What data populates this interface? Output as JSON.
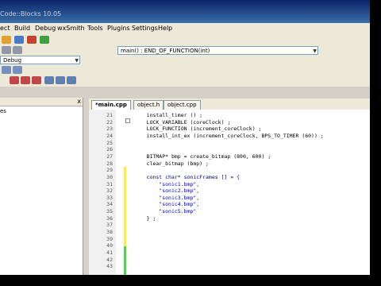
{
  "window": {
    "title": "Code::Blocks 10.05"
  },
  "menu": [
    "ect",
    "Build",
    "Debug",
    "wxSmith",
    "Tools",
    "Plugins",
    "Settings",
    "Help"
  ],
  "toolbar": {
    "build_target": "Debug",
    "function_selector": "main() : END_OF_FUNCTION(int)"
  },
  "left_panel": {
    "close_glyph": "x",
    "tab_fragment": "es"
  },
  "tabs": [
    "*main.cpp",
    "object.h",
    "object.cpp"
  ],
  "editor": {
    "lines": [
      {
        "n": "21",
        "t": "    install_timer () ;"
      },
      {
        "n": "22",
        "t": "    LOCK_VARIABLE (coreClock) ;"
      },
      {
        "n": "23",
        "t": "    LOCK_FUNCTION (increment_coreClock) ;"
      },
      {
        "n": "24",
        "t": "    install_int_ex (increment_coreClock, BPS_TO_TIMER (60)) ;"
      },
      {
        "n": "25",
        "t": ""
      },
      {
        "n": "26",
        "t": ""
      },
      {
        "n": "27",
        "t": "    BITMAP* bmp = create_bitmap (800, 600) ;"
      },
      {
        "n": "28",
        "t": "    clear_bitmap (bmp) ;"
      },
      {
        "n": "29",
        "t": ""
      },
      {
        "n": "30",
        "t": "    const char* sonicFrames [] = {"
      },
      {
        "n": "31",
        "t": "        \"sonic1.bmp\","
      },
      {
        "n": "32",
        "t": "        \"sonic2.bmp\","
      },
      {
        "n": "33",
        "t": "        \"sonic3.bmp\","
      },
      {
        "n": "34",
        "t": "        \"sonic4.bmp\","
      },
      {
        "n": "35",
        "t": "        \"sonic5.bmp\""
      },
      {
        "n": "36",
        "t": "    } ;"
      },
      {
        "n": "37",
        "t": ""
      },
      {
        "n": "38",
        "t": ""
      },
      {
        "n": "39",
        "t": ""
      },
      {
        "n": "40",
        "t": ""
      },
      {
        "n": "41",
        "t": ""
      },
      {
        "n": "42",
        "t": ""
      },
      {
        "n": "43",
        "t": ""
      }
    ]
  }
}
